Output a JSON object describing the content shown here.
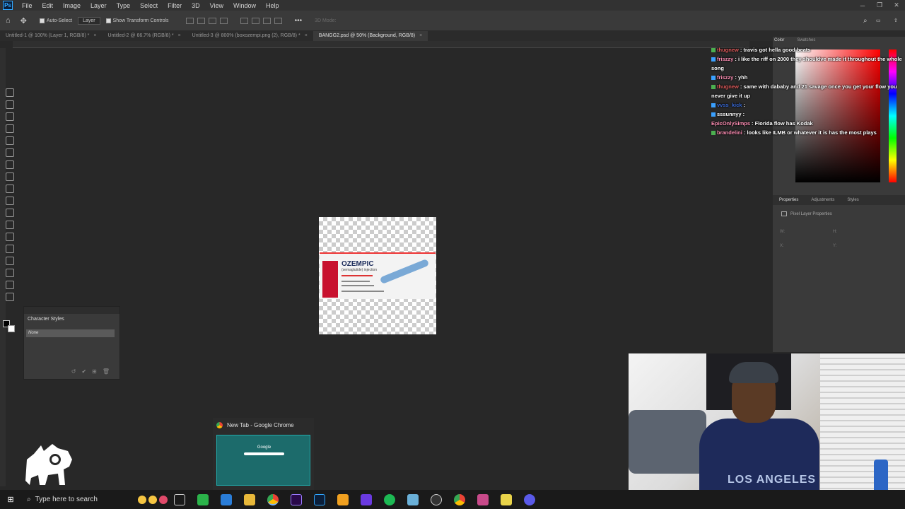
{
  "menubar": {
    "logo": "Ps",
    "items": [
      "File",
      "Edit",
      "Image",
      "Layer",
      "Type",
      "Select",
      "Filter",
      "3D",
      "View",
      "Window",
      "Help"
    ]
  },
  "options": {
    "auto_select": "Auto-Select",
    "layer_dropdown": "Layer",
    "show_transform": "Show Transform Controls",
    "mode_3d": "3D Mode:"
  },
  "tabs": [
    {
      "label": "Untitled-1 @ 100% (Layer 1, RGB/8) *",
      "active": false
    },
    {
      "label": "Untitled-2 @ 66.7% (RGB/8) *",
      "active": false
    },
    {
      "label": "Untitled-3 @ 800% (boxozempi.png (2), RGB/8) *",
      "active": false
    },
    {
      "label": "BANGG2.psd @ 50% (Background, RGB/8)",
      "active": true
    }
  ],
  "canvas": {
    "product_name": "OZEMPIC",
    "product_sub": "(semaglutide) injection"
  },
  "character_styles": {
    "title": "Character Styles",
    "none_label": "None"
  },
  "color_panel": {
    "tab_color": "Color",
    "tab_swatches": "Swatches",
    "accent": "#ff0000"
  },
  "properties_panel": {
    "tabs": [
      "Properties",
      "Adjustments",
      "Styles"
    ],
    "pixel_layer": "Pixel Layer Properties",
    "w_label": "W:",
    "h_label": "H:",
    "x_label": "X:",
    "y_label": "Y:"
  },
  "chat": [
    {
      "user": "thugnew",
      "color": "#e05c5c",
      "text": "travis got hella good beats"
    },
    {
      "user": "friszzy",
      "color": "#ff8fb5",
      "text": "i like the riff on 2000 they shouldve made it throughout the whole song"
    },
    {
      "user": "friszzy",
      "color": "#ff8fb5",
      "text": "yhh"
    },
    {
      "user": "thugnew",
      "color": "#e05c5c",
      "text": "same with dababy and 21 savage once you get your flow you never give it up"
    },
    {
      "user": "vvss_kick",
      "color": "#3a6bd8",
      "text": ""
    },
    {
      "user": "sssunnyy",
      "color": "#ffffff",
      "text": ""
    },
    {
      "user": "EpicOnlySimps",
      "color": "#ff8fb5",
      "text": "Florida flow has Kodak"
    },
    {
      "user": "brandelini",
      "color": "#ff8fb5",
      "text": "looks like ILMB or whatever it is has the most plays"
    }
  ],
  "chrome_thumb": {
    "title": "New Tab - Google Chrome",
    "google": "Google"
  },
  "taskbar": {
    "search_placeholder": "Type here to search"
  },
  "webcam": {
    "shirt_text": "LOS ANGELES"
  }
}
